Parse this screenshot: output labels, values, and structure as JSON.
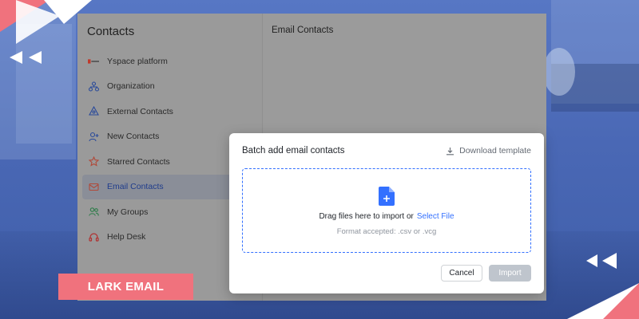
{
  "app": {
    "title": "Contacts"
  },
  "sidebar": {
    "items": [
      {
        "label": "Yspace platform",
        "icon": "yspace-logo-icon"
      },
      {
        "label": "Organization",
        "icon": "organization-icon"
      },
      {
        "label": "External Contacts",
        "icon": "external-contacts-icon"
      },
      {
        "label": "New Contacts",
        "icon": "add-user-icon"
      },
      {
        "label": "Starred Contacts",
        "icon": "star-icon"
      },
      {
        "label": "Email Contacts",
        "icon": "email-icon",
        "active": true
      },
      {
        "label": "My Groups",
        "icon": "groups-icon"
      },
      {
        "label": "Help Desk",
        "icon": "help-desk-icon"
      }
    ]
  },
  "main": {
    "title": "Email Contacts"
  },
  "modal": {
    "title": "Batch add email contacts",
    "download_label": "Download template",
    "drop_text": "Drag files here to import or",
    "select_file_label": "Select File",
    "format_text": "Format accepted: .csv or .vcg",
    "cancel_label": "Cancel",
    "import_label": "Import"
  },
  "badge": {
    "label": "LARK EMAIL"
  },
  "colors": {
    "accent": "#3370ff",
    "badge": "#f0727d",
    "overlay_blue": "#4a6bb8",
    "import_disabled": "#bfc5cd"
  }
}
